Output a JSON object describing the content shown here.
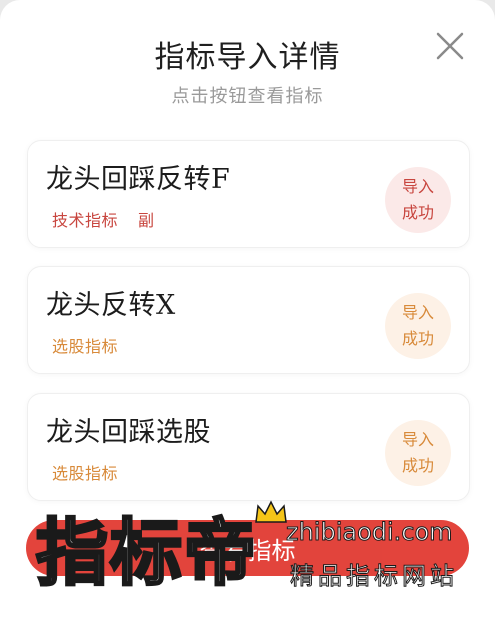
{
  "header": {
    "title": "指标导入详情",
    "subtitle": "点击按钮查看指标"
  },
  "close_icon": "close-icon",
  "cards": [
    {
      "title": "龙头回踩反转F",
      "tags": [
        {
          "label": "技术指标",
          "color": "#c8463f"
        },
        {
          "label": "副",
          "color": "#c8463f"
        }
      ],
      "badge": {
        "line1": "导入",
        "line2": "成功",
        "color": "#c8463f",
        "bg": "#fbe9e8"
      }
    },
    {
      "title": "龙头反转X",
      "tags": [
        {
          "label": "选股指标",
          "color": "#d88a3a"
        }
      ],
      "badge": {
        "line1": "导入",
        "line2": "成功",
        "color": "#d88a3a",
        "bg": "#fdf1e6"
      }
    },
    {
      "title": "龙头回踩选股",
      "tags": [
        {
          "label": "选股指标",
          "color": "#d88a3a"
        }
      ],
      "badge": {
        "line1": "导入",
        "line2": "成功",
        "color": "#d88a3a",
        "bg": "#fdf1e6"
      }
    }
  ],
  "bottom_button": {
    "label": "查看指标"
  },
  "watermark": {
    "brand": "指标帝",
    "url": "zhibiaodi.com",
    "slogan": "精品指标网站"
  }
}
